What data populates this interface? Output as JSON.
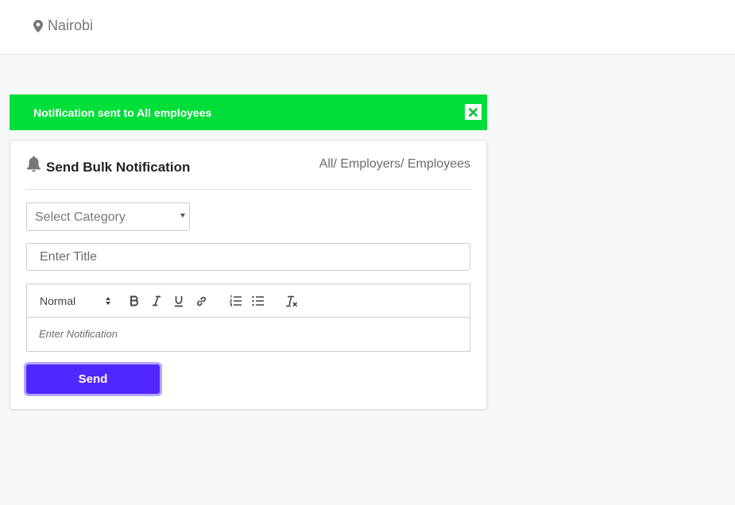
{
  "header": {
    "location_icon": "map-marker-icon",
    "location": "Nairobi"
  },
  "alert": {
    "message": "Notification sent to All employees",
    "close_icon": "close-icon",
    "color": "#00de3a"
  },
  "card": {
    "title_icon": "bell-icon",
    "title": "Send Bulk Notification",
    "breadcrumb": "All/ Employers/ Employees",
    "category_select": {
      "selected": "Select Category"
    },
    "title_input": {
      "placeholder": "Enter Title",
      "value": ""
    },
    "editor": {
      "toolbar": {
        "format": "Normal",
        "buttons": [
          "bold-icon",
          "italic-icon",
          "underline-icon",
          "link-icon",
          "ordered-list-icon",
          "bullet-list-icon",
          "clear-format-icon"
        ]
      },
      "placeholder": "Enter Notification"
    },
    "send_label": "Send",
    "send_color": "#5127ff"
  }
}
